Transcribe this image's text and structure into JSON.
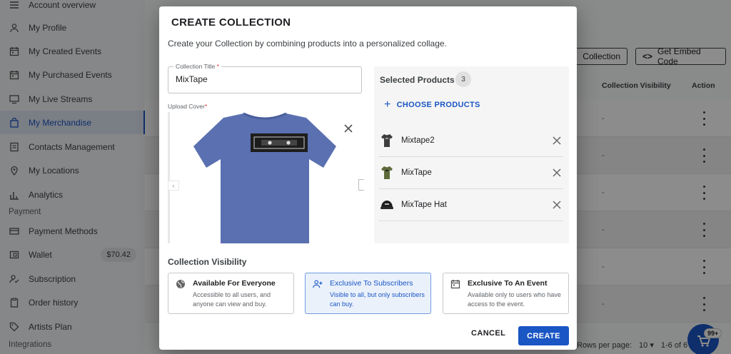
{
  "sidebar": {
    "items": [
      {
        "label": "Account overview",
        "icon": "list-icon"
      },
      {
        "label": "My Profile",
        "icon": "person-icon"
      },
      {
        "label": "My Created Events",
        "icon": "calendar-icon"
      },
      {
        "label": "My Purchased Events",
        "icon": "calendar-icon"
      },
      {
        "label": "My Live Streams",
        "icon": "monitor-icon"
      },
      {
        "label": "My Merchandise",
        "icon": "bag-icon",
        "active": true
      },
      {
        "label": "Contacts Management",
        "icon": "contacts-icon"
      },
      {
        "label": "My Locations",
        "icon": "location-pin-icon"
      },
      {
        "label": "Analytics",
        "icon": "bar-chart-icon"
      }
    ],
    "payment_label": "Payment",
    "payment_items": [
      {
        "label": "Payment Methods",
        "icon": "card-icon"
      },
      {
        "label": "Wallet",
        "icon": "wallet-icon",
        "badge": "$70.42"
      },
      {
        "label": "Subscription",
        "icon": "subscription-icon"
      },
      {
        "label": "Order history",
        "icon": "clipboard-icon"
      },
      {
        "label": "Artists Plan",
        "icon": "tag-icon"
      }
    ],
    "integrations_label": "Integrations"
  },
  "main": {
    "collection_btn": "Collection",
    "embed_btn": "Get Embed Code",
    "embed_icon": "<>",
    "col_visibility": "Collection Visibility",
    "col_action": "Action",
    "row_dash": "-",
    "rows_per_page_label": "Rows per page:",
    "rows_per_page": "10",
    "pagination": "1-6 of 6",
    "cart_badge": "99+"
  },
  "modal": {
    "title": "CREATE COLLECTION",
    "subtitle": "Create your Collection by combining products into a personalized collage.",
    "collection_title_label": "Collection Title",
    "collection_title_value": "MixTape",
    "upload_cover_label": "Upload Cover",
    "required_mark": "*",
    "selected_products_label": "Selected Products",
    "selected_count": "3",
    "choose_products": "CHOOSE PRODUCTS",
    "products": [
      {
        "name": "Mixtape2",
        "thumb": "dark-tshirt-icon"
      },
      {
        "name": "MixTape",
        "thumb": "olive-tshirt-icon"
      },
      {
        "name": "MixTape Hat",
        "thumb": "hat-icon"
      }
    ],
    "visibility_title": "Collection Visibility",
    "visibility_options": [
      {
        "title": "Available For Everyone",
        "desc": "Accessible to all users, and anyone can view and buy.",
        "icon": "globe-icon",
        "selected": false
      },
      {
        "title": "Exclusive To Subscribers",
        "desc": "Visible to all, but only subscribers can buy.",
        "icon": "add-person-icon",
        "selected": true
      },
      {
        "title": "Exclusive To An Event",
        "desc": "Available only to users who have access to the event.",
        "icon": "event-calendar-icon",
        "selected": false
      }
    ],
    "cancel": "CANCEL",
    "create": "CREATE"
  },
  "colors": {
    "accent": "#1a56c4",
    "tshirt": "#5a70b0",
    "required": "#d93025"
  }
}
